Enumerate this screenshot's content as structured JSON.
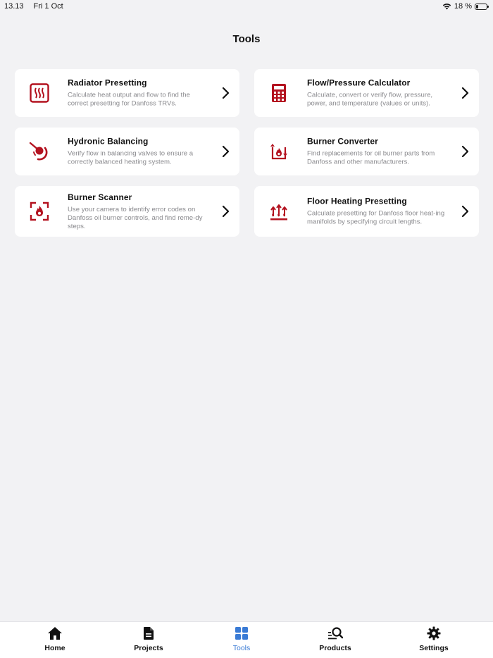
{
  "status_bar": {
    "time": "13.13",
    "date": "Fri 1 Oct",
    "battery_text": "18 %",
    "battery_level": 0.18
  },
  "page": {
    "title": "Tools"
  },
  "colors": {
    "icon_red": "#b3121f",
    "active_blue": "#3a7bd5"
  },
  "tools": [
    {
      "title": "Radiator Presetting",
      "description": "Calculate heat output and flow to find the correct presetting for Danfoss TRVs.",
      "icon": "radiator-icon"
    },
    {
      "title": "Flow/Pressure Calculator",
      "description": "Calculate, convert or verify flow, pressure, power, and temperature (values or units).",
      "icon": "calculator-icon"
    },
    {
      "title": "Hydronic Balancing",
      "description": "Verify flow in balancing valves to ensure a correctly balanced heating system.",
      "icon": "balancing-valve-icon"
    },
    {
      "title": "Burner Converter",
      "description": "Find replacements for oil burner parts from Danfoss and other manufacturers.",
      "icon": "burner-convert-icon"
    },
    {
      "title": "Burner Scanner",
      "description": "Use your camera to identify error codes on Danfoss oil burner controls, and find reme-dy steps.",
      "icon": "flame-scan-icon"
    },
    {
      "title": "Floor Heating Presetting",
      "description": "Calculate presetting for Danfoss floor heat-ing manifolds by specifying circuit lengths.",
      "icon": "floor-heating-icon"
    }
  ],
  "tabbar": {
    "items": [
      {
        "label": "Home",
        "icon": "home-icon"
      },
      {
        "label": "Projects",
        "icon": "document-icon"
      },
      {
        "label": "Tools",
        "icon": "grid-icon",
        "active": true
      },
      {
        "label": "Products",
        "icon": "search-list-icon"
      },
      {
        "label": "Settings",
        "icon": "gear-icon"
      }
    ]
  }
}
